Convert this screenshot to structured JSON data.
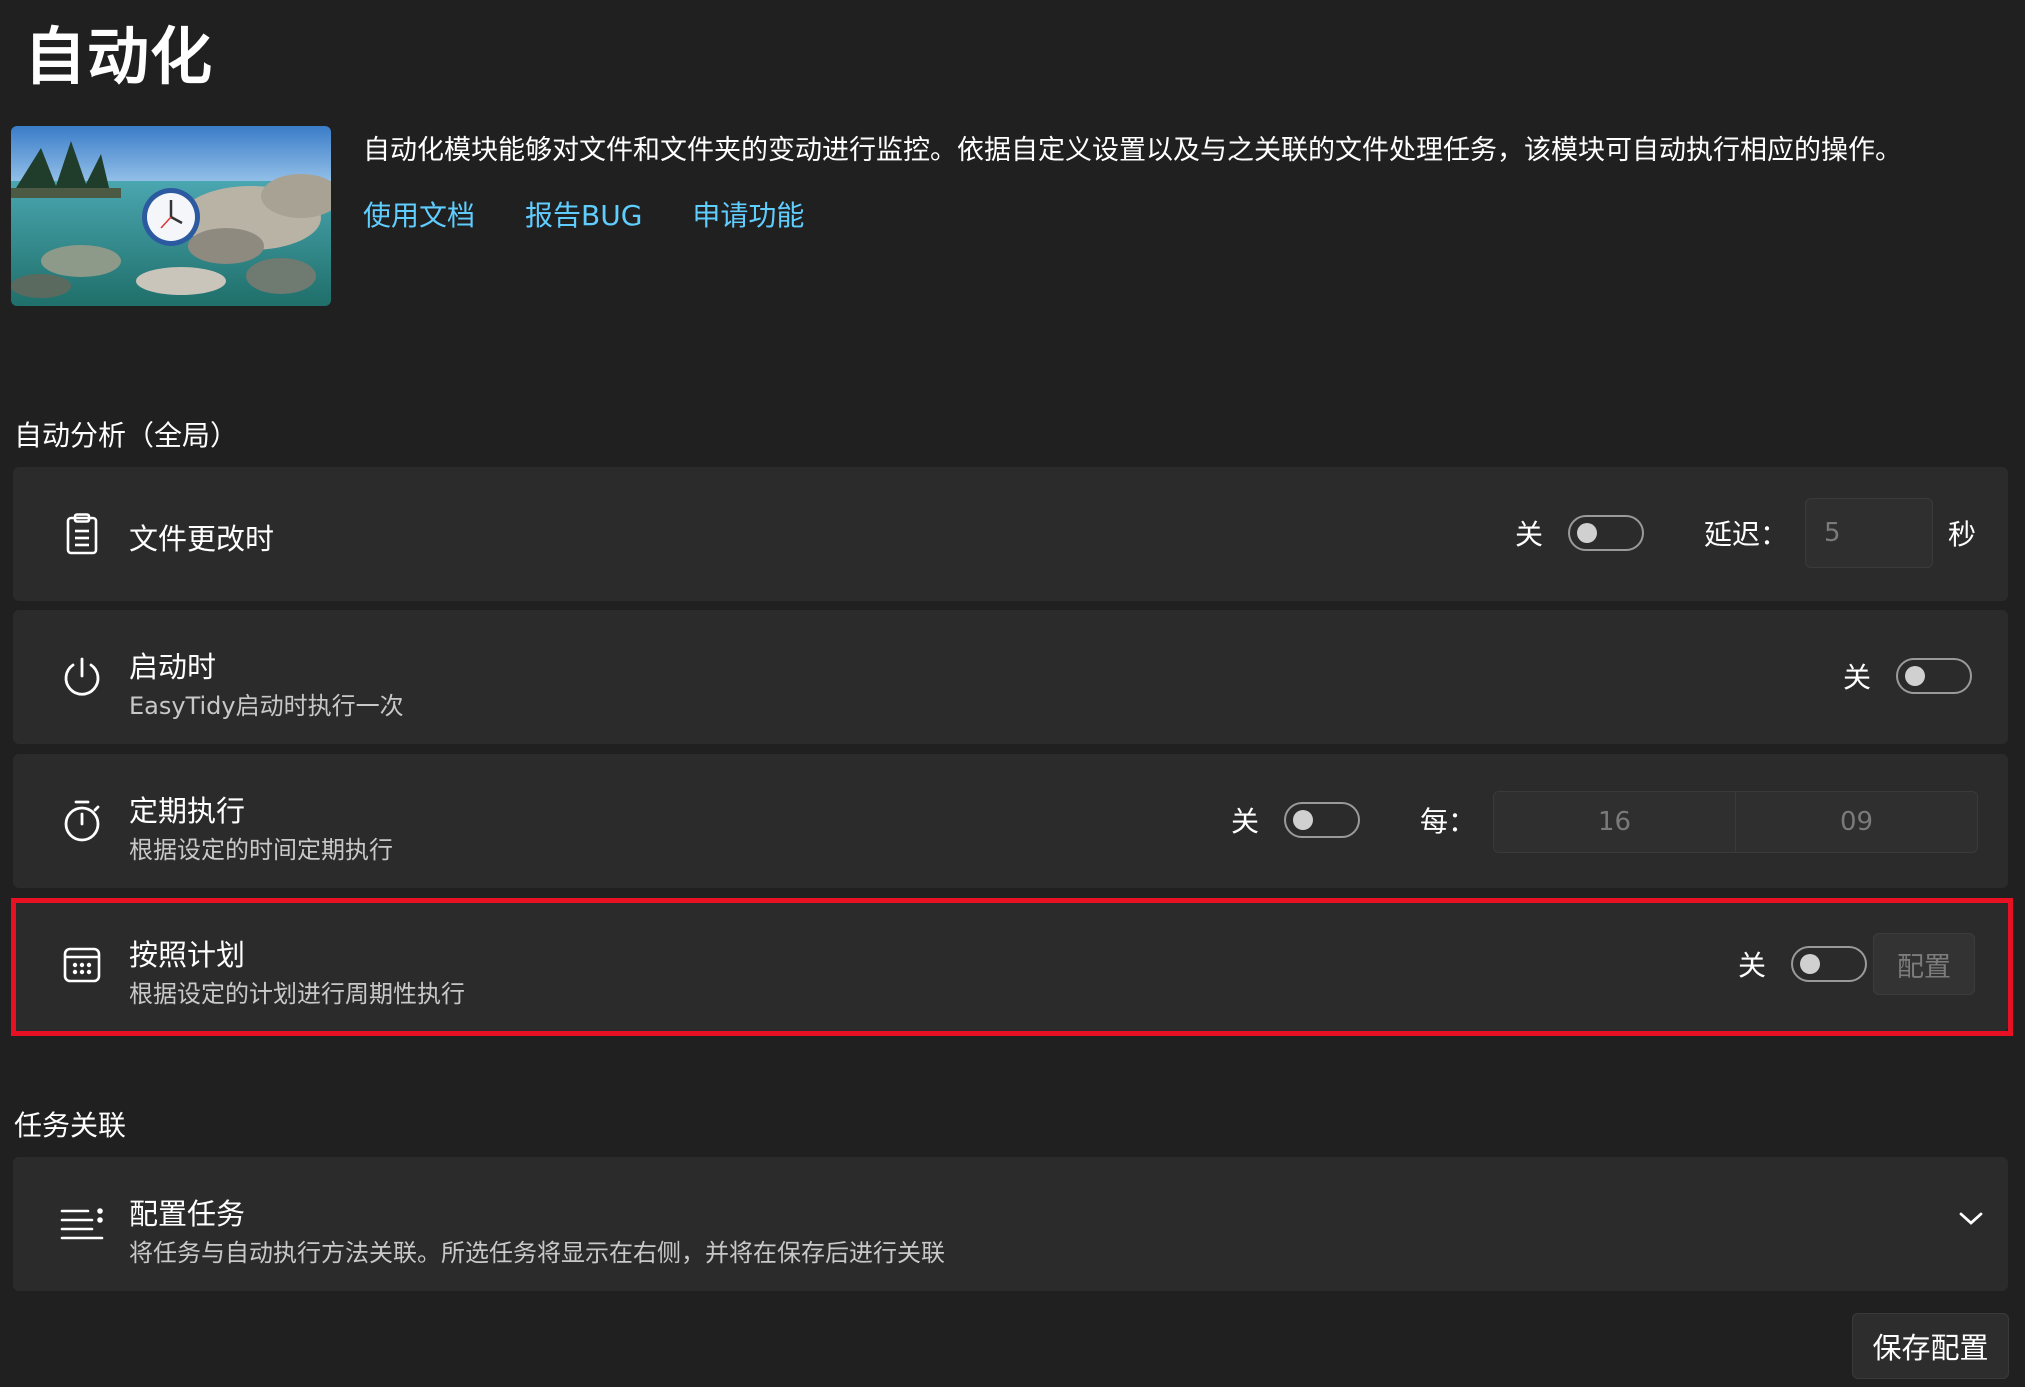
{
  "page": {
    "title": "自动化",
    "description": "自动化模块能够对文件和文件夹的变动进行监控。依据自定义设置以及与之关联的文件处理任务，该模块可自动执行相应的操作。",
    "links": [
      "使用文档",
      "报告BUG",
      "申请功能"
    ]
  },
  "sections": {
    "auto_analysis": "自动分析（全局）",
    "task_link": "任务关联"
  },
  "rows": {
    "file_change": {
      "title": "文件更改时",
      "toggle_state": "关",
      "toggle_on": false,
      "delay_label": "延迟：",
      "delay_value": "5",
      "delay_unit": "秒",
      "icon": "clipboard-list-icon"
    },
    "on_startup": {
      "title": "启动时",
      "subtitle": "EasyTidy启动时执行一次",
      "toggle_state": "关",
      "toggle_on": false,
      "icon": "power-icon"
    },
    "periodic": {
      "title": "定期执行",
      "subtitle": "根据设定的时间定期执行",
      "toggle_state": "关",
      "toggle_on": false,
      "every_label": "每：",
      "hours": "16",
      "minutes": "09",
      "icon": "stopwatch-icon"
    },
    "schedule": {
      "title": "按照计划",
      "subtitle": "根据设定的计划进行周期性执行",
      "toggle_state": "关",
      "toggle_on": false,
      "config_label": "配置",
      "icon": "calendar-icon"
    },
    "config_tasks": {
      "title": "配置任务",
      "subtitle": "将任务与自动执行方法关联。所选任务将显示在右侧，并将在保存后进行关联",
      "icon": "list-icon"
    }
  },
  "actions": {
    "save": "保存配置"
  },
  "colors": {
    "background": "#202020",
    "card": "#2b2b2b",
    "link": "#60cdff",
    "highlight": "#e81123"
  }
}
